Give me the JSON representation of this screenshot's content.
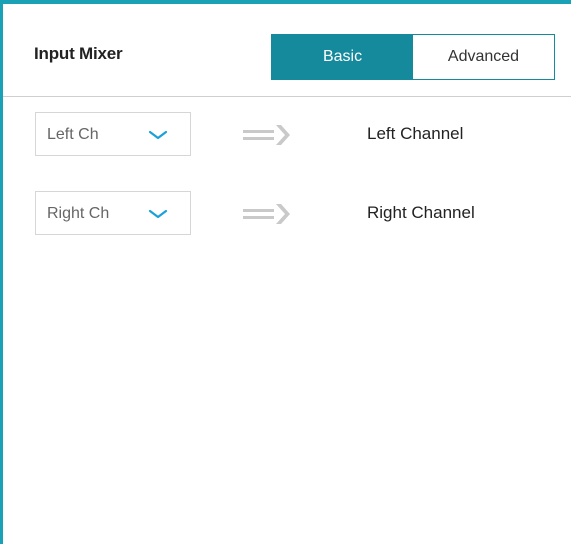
{
  "panel": {
    "title": "Input Mixer",
    "accent_color": "#1aa1b5",
    "active_tab_color": "#158a9c"
  },
  "mode_toggle": {
    "options": [
      {
        "label": "Basic",
        "selected": true
      },
      {
        "label": "Advanced",
        "selected": false
      }
    ]
  },
  "mappings": [
    {
      "source_value": "Left Ch",
      "target_label": "Left Channel",
      "icon": "chevron-down-icon",
      "arrow_icon": "double-line-arrow-icon"
    },
    {
      "source_value": "Right Ch",
      "target_label": "Right Channel",
      "icon": "chevron-down-icon",
      "arrow_icon": "double-line-arrow-icon"
    }
  ]
}
